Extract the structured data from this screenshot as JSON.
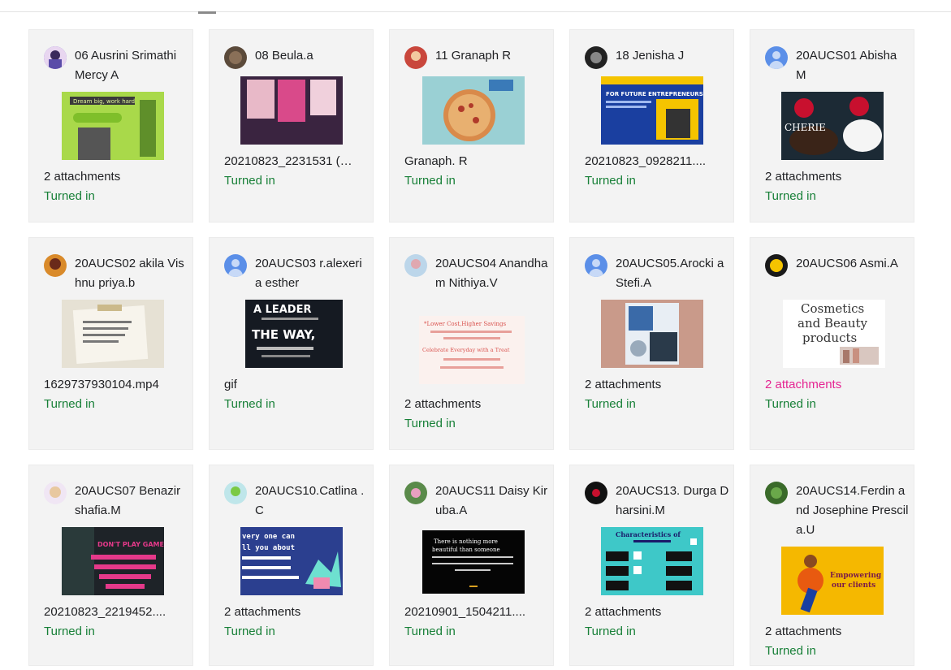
{
  "status_color": "#188038",
  "highlight_color": "#e52592",
  "cards": [
    {
      "name": "06 Ausrini Srimathi Mercy A",
      "file": "2 attachments",
      "status": "Turned in",
      "thumb_text": "Dream big, work hard"
    },
    {
      "name": "08 Beula.a",
      "file": "20210823_2231531 (…",
      "status": "Turned in"
    },
    {
      "name": "11 Granaph R",
      "file": "Granaph. R",
      "status": "Turned in"
    },
    {
      "name": "18 Jenisha J",
      "file": "20210823_0928211....",
      "status": "Turned in",
      "thumb_text": "FOR FUTURE ENTREPRENEURS"
    },
    {
      "name": "20AUCS01 Abisha M",
      "file": "2 attachments",
      "status": "Turned in",
      "thumb_text": "CHERIE"
    },
    {
      "name": "20AUCS02 akila Vishnu priya.b",
      "file": "1629737930104.mp4",
      "status": "Turned in"
    },
    {
      "name": "20AUCS03 r.alexeria esther",
      "file": "gif",
      "status": "Turned in",
      "thumb_text": "A LEADER",
      "thumb_text2": "THE WAY,"
    },
    {
      "name": "20AUCS04 Anandham Nithiya.V",
      "file": "2 attachments",
      "status": "Turned in",
      "thumb_text": "*Lower Cost,Higher Savings",
      "thumb_text2": "Celebrate Everyday with a Treat"
    },
    {
      "name": "20AUCS05.Arocki a Stefi.A",
      "file": "2 attachments",
      "status": "Turned in"
    },
    {
      "name": "20AUCS06 Asmi.A",
      "file": "2 attachments",
      "status": "Turned in",
      "thumb_text": "Cosmetics",
      "thumb_text2": "and Beauty",
      "thumb_text3": "products"
    },
    {
      "name": "20AUCS07 Benazir shafia.M",
      "file": "20210823_2219452....",
      "status": "Turned in",
      "thumb_text": "DON'T PLAY GAMES"
    },
    {
      "name": "20AUCS10.Catlina . C",
      "file": "2 attachments",
      "status": "Turned in",
      "thumb_text": "very one can",
      "thumb_text2": "ll you about"
    },
    {
      "name": "20AUCS11 Daisy Kiruba.A",
      "file": "20210901_1504211....",
      "status": "Turned in",
      "thumb_text": "There is nothing more",
      "thumb_text2": "beautiful than someone"
    },
    {
      "name": "20AUCS13. Durga Dharsini.M",
      "file": "2 attachments",
      "status": "Turned in",
      "thumb_text": "Characteristics of"
    },
    {
      "name": "20AUCS14.Ferdin and Josephine Prescila.U",
      "file": "2 attachments",
      "status": "Turned in",
      "thumb_text": "Empowering",
      "thumb_text2": "our clients"
    }
  ]
}
